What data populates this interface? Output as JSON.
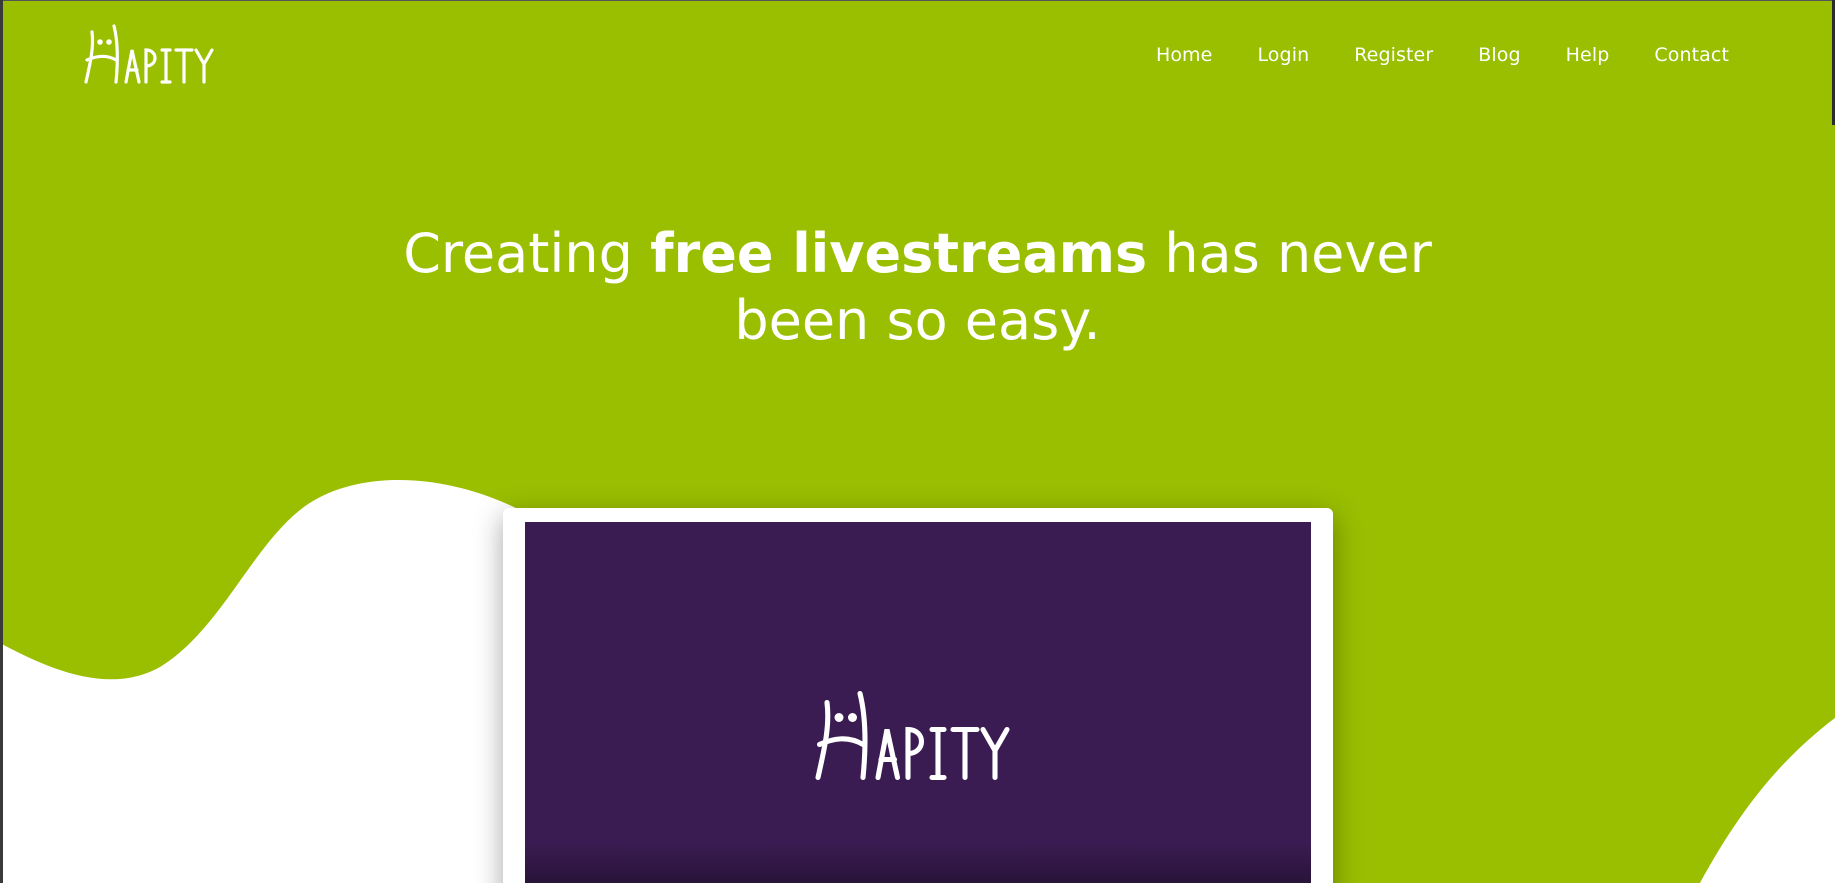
{
  "brand": {
    "name": "HAPITY",
    "colors": {
      "green": "#9abe00",
      "purple": "#3a1c52",
      "white": "#ffffff"
    }
  },
  "nav": {
    "items": [
      {
        "label": "Home"
      },
      {
        "label": "Login"
      },
      {
        "label": "Register"
      },
      {
        "label": "Blog"
      },
      {
        "label": "Help"
      },
      {
        "label": "Contact"
      }
    ]
  },
  "hero": {
    "title_part1": "Creating ",
    "title_bold": "free livestreams",
    "title_part2": " has never",
    "title_line2": "been so easy."
  },
  "video": {
    "logo": "hapity-logo"
  }
}
